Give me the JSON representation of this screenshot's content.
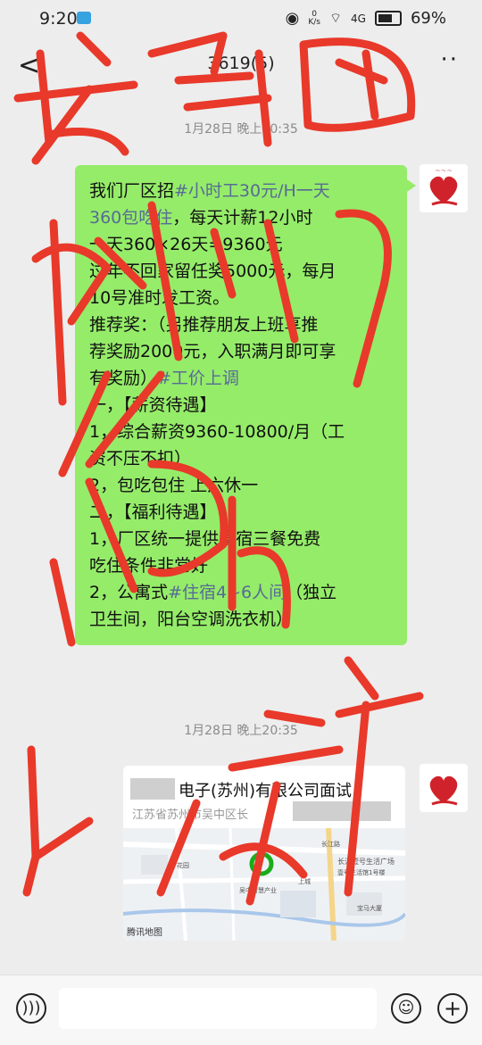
{
  "status": {
    "time": "9:20",
    "net_speed_top": "0",
    "net_speed_unit": "K/s",
    "signal": "4G",
    "battery": "69%"
  },
  "header": {
    "title": "3619(5)"
  },
  "messages": {
    "ts1": "1月28日 晚上20:35",
    "ts2": "1月28日 晚上20:35",
    "bubble_lines": [
      {
        "plain": "我们厂区招",
        "tag": "#小时工30元/H一天"
      },
      {
        "plain": "",
        "tag": "360包吃住",
        "after": "，每天计薪12小时"
      },
      {
        "plain": "一天360×26天=9360元"
      },
      {
        "plain": "过年不回家留任奖5000元，每月"
      },
      {
        "plain": "10号准时发工资。"
      },
      {
        "plain": "推荐奖：（另推荐朋友上班享推"
      },
      {
        "plain": "荐奖励2000元，入职满月即可享"
      },
      {
        "plain": "有奖励）",
        "tag": "#工价上调"
      },
      {
        "plain": "一，【薪资待遇】"
      },
      {
        "plain": "1，综合薪资9360-10800/月（工"
      },
      {
        "plain": "资不压不扣）"
      },
      {
        "plain": "2，包吃包住 上六休一"
      },
      {
        "plain": "二，【福利待遇】"
      },
      {
        "plain": "1，厂区统一提供食宿三餐免费"
      },
      {
        "plain": "吃住条件非常好"
      },
      {
        "plain": "2，公寓式",
        "tag": "#住宿4~6人间",
        "after": "（独立"
      },
      {
        "plain": "卫生间，阳台空调洗衣机）"
      }
    ],
    "location": {
      "title": "电子(苏州)有限公司面试",
      "address": "江苏省苏州市吴中区长",
      "map_credit": "腾讯地图",
      "map_labels": [
        "长江路",
        "长江壹号生活广场",
        "壹号生活馆1号楼",
        "上城",
        "宝马大厦",
        "吴中智慧产业科技园",
        "花园"
      ]
    }
  },
  "overlay_text": [
    "发到",
    "我们",
    "群",
    "这个群"
  ],
  "colors": {
    "bubble": "#95ec69",
    "bg": "#ededed",
    "tag": "#576b95",
    "scribble": "#e8392a"
  }
}
